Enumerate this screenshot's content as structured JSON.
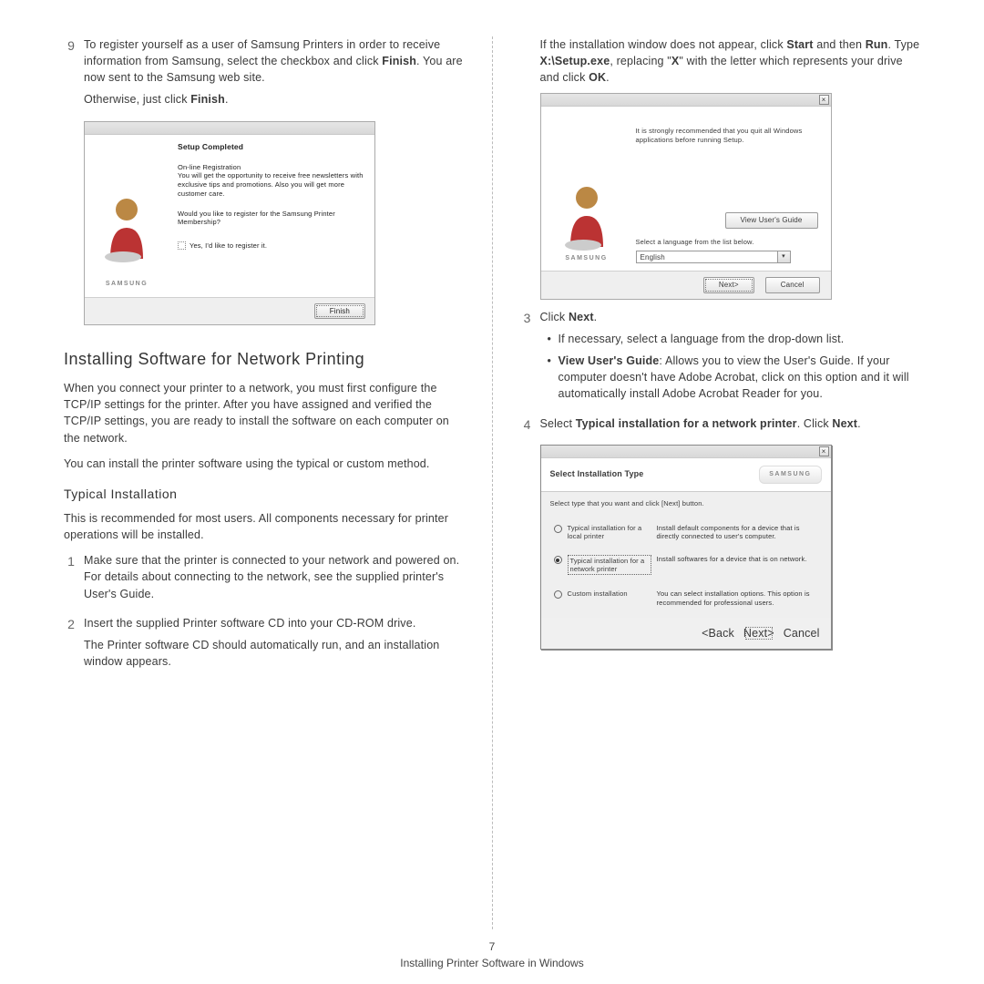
{
  "footer": {
    "page": "7",
    "title": "Installing Printer Software in Windows"
  },
  "left": {
    "step9_num": "9",
    "step9_p1": "To register yourself as a user of Samsung Printers in order to receive information from Samsung, select the checkbox and click ",
    "step9_finish": "Finish",
    "step9_p1b": ". You are now sent to the Samsung web site.",
    "step9_p2a": "Otherwise, just click ",
    "step9_p2b": "Finish",
    "step9_p2c": ".",
    "h2": "Installing Software for Network Printing",
    "p_intro1": "When you connect your printer to a network, you must first configure the TCP/IP settings for the printer. After you have assigned and verified the TCP/IP settings, you are ready to install the software on each computer on the network.",
    "p_intro2": "You can install the printer software using the typical or custom method.",
    "h3": "Typical Installation",
    "p_typ": "This is recommended for most users. All components necessary for printer operations will be installed.",
    "s1_num": "1",
    "s1": "Make sure that the printer is connected to your network and powered on. For details about connecting to the network, see the supplied printer's User's Guide.",
    "s2_num": "2",
    "s2a": "Insert the supplied Printer software CD into your CD-ROM drive.",
    "s2b": "The Printer software CD should automatically run, and an installation window appears."
  },
  "right": {
    "p_top_a": "If the installation window does not appear, click ",
    "p_top_b": "Start",
    "p_top_c": " and then ",
    "p_top_d": "Run",
    "p_top_e": ". Type ",
    "p_top_f": "X:\\Setup.exe",
    "p_top_g": ", replacing \"",
    "p_top_h": "X",
    "p_top_i": "\" with the letter which represents your drive and click ",
    "p_top_j": "OK",
    "p_top_k": ".",
    "s3_num": "3",
    "s3a": "Click ",
    "s3b": "Next",
    "s3c": ".",
    "b1": "If necessary, select a language from the drop-down list.",
    "b2a": "View User's Guide",
    "b2b": ": Allows you to view the User's Guide. If your computer doesn't have Adobe Acrobat, click on this option and it will automatically install Adobe Acrobat Reader for you.",
    "s4_num": "4",
    "s4a": "Select ",
    "s4b": "Typical installation for a network printer",
    "s4c": ". Click ",
    "s4d": "Next",
    "s4e": "."
  },
  "dlg1": {
    "title": "Setup Completed",
    "reg_t": "On-line Registration",
    "reg_p": "You will get the opportunity to receive free newsletters with exclusive tips and promotions. Also you will get more customer care.",
    "q": "Would you like to register for the Samsung Printer Membership?",
    "chk": "Yes, I'd like to register it.",
    "brand": "SAMSUNG",
    "finish": "Finish"
  },
  "dlg2": {
    "rec": "It is strongly recommended that you quit all Windows applications before running Setup.",
    "view": "View User's Guide",
    "lang_lbl": "Select a language from the list below.",
    "lang_val": "English",
    "brand": "SAMSUNG",
    "next": "Next>",
    "cancel": "Cancel"
  },
  "dlg3": {
    "header": "Select Installation Type",
    "brand": "SAMSUNG",
    "instr": "Select type that you want and click [Next] button.",
    "opt1_lbl": "Typical installation for a local printer",
    "opt1_desc": "Install default components for a device that is directly connected to user's computer.",
    "opt2_lbl": "Typical installation for a network printer",
    "opt2_desc": "Install softwares for a device that is on network.",
    "opt3_lbl": "Custom installation",
    "opt3_desc": "You can select installation options. This option is recommended for professional users.",
    "back": "<Back",
    "next": "Next>",
    "cancel": "Cancel"
  }
}
